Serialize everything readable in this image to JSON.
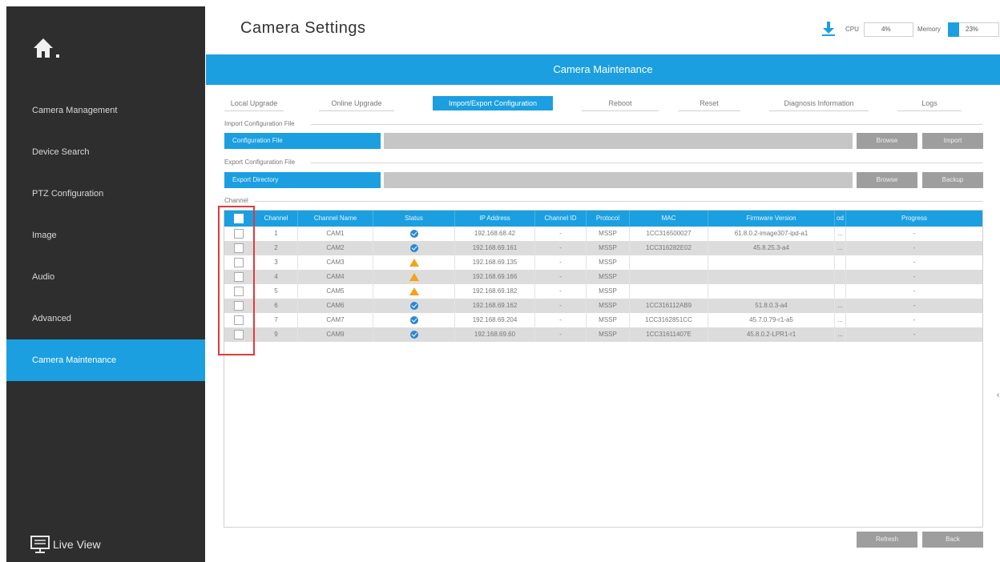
{
  "sidebar": {
    "items": [
      {
        "label": "Camera Management",
        "active": false
      },
      {
        "label": "Device Search",
        "active": false
      },
      {
        "label": "PTZ Configuration",
        "active": false
      },
      {
        "label": "Image",
        "active": false
      },
      {
        "label": "Audio",
        "active": false
      },
      {
        "label": "Advanced",
        "active": false
      },
      {
        "label": "Camera Maintenance",
        "active": true
      }
    ],
    "live_view_label": "Live View"
  },
  "header": {
    "title": "Camera Settings",
    "cpu_label": "CPU",
    "cpu_value": "4%",
    "memory_label": "Memory",
    "memory_value": "23%"
  },
  "banner": "Camera Maintenance",
  "tabs": [
    {
      "label": "Local Upgrade",
      "active": false
    },
    {
      "label": "Online Upgrade",
      "active": false
    },
    {
      "label": "Import/Export Configuration",
      "active": true
    },
    {
      "label": "Reboot",
      "active": false
    },
    {
      "label": "Reset",
      "active": false
    },
    {
      "label": "Diagnosis Information",
      "active": false
    },
    {
      "label": "Logs",
      "active": false
    }
  ],
  "import_section": {
    "title": "Import Configuration File",
    "field_label": "Configuration File",
    "browse_label": "Browse",
    "action_label": "Import"
  },
  "export_section": {
    "title": "Export Configuration File",
    "field_label": "Export Directory",
    "browse_label": "Browse",
    "action_label": "Backup"
  },
  "channel_section": {
    "title": "Channel",
    "columns": [
      "",
      "Channel",
      "Channel Name",
      "Status",
      "IP Address",
      "Channel ID",
      "Protocol",
      "MAC",
      "Firmware Version",
      "od",
      "Progress"
    ],
    "rows": [
      {
        "channel": "1",
        "name": "CAM1",
        "status": "ok",
        "ip": "192.168.68.42",
        "channel_id": "-",
        "protocol": "MSSP",
        "mac": "1CC316500027",
        "firmware": "61.8.0.2-image307-ipd-a1",
        "od": "...",
        "progress": "-"
      },
      {
        "channel": "2",
        "name": "CAM2",
        "status": "ok",
        "ip": "192.168.69.161",
        "channel_id": "-",
        "protocol": "MSSP",
        "mac": "1CC316282E02",
        "firmware": "45.8.25.3-a4",
        "od": "...",
        "progress": "-"
      },
      {
        "channel": "3",
        "name": "CAM3",
        "status": "warning",
        "ip": "192.168.69.135",
        "channel_id": "-",
        "protocol": "MSSP",
        "mac": "",
        "firmware": "",
        "od": "",
        "progress": "-"
      },
      {
        "channel": "4",
        "name": "CAM4",
        "status": "warning",
        "ip": "192.168.69.166",
        "channel_id": "-",
        "protocol": "MSSP",
        "mac": "",
        "firmware": "",
        "od": "",
        "progress": "-"
      },
      {
        "channel": "5",
        "name": "CAM5",
        "status": "warning",
        "ip": "192.168.69.182",
        "channel_id": "-",
        "protocol": "MSSP",
        "mac": "",
        "firmware": "",
        "od": "",
        "progress": "-"
      },
      {
        "channel": "6",
        "name": "CAM6",
        "status": "ok",
        "ip": "192.168.69.162",
        "channel_id": "-",
        "protocol": "MSSP",
        "mac": "1CC316112AB9",
        "firmware": "51.8.0.3-a4",
        "od": "...",
        "progress": "-"
      },
      {
        "channel": "7",
        "name": "CAM7",
        "status": "ok",
        "ip": "192.168.69.204",
        "channel_id": "-",
        "protocol": "MSSP",
        "mac": "1CC3162851CC",
        "firmware": "45.7.0.79-r1-a5",
        "od": "...",
        "progress": "-"
      },
      {
        "channel": "9",
        "name": "CAM9",
        "status": "ok",
        "ip": "192.168.69.60",
        "channel_id": "-",
        "protocol": "MSSP",
        "mac": "1CC31611407E",
        "firmware": "45.8.0.2-LPR1-r1",
        "od": "...",
        "progress": "-"
      }
    ]
  },
  "footer": {
    "refresh_label": "Refresh",
    "back_label": "Back"
  },
  "colors": {
    "accent": "#1b9fe0",
    "sidebar_bg": "#2e2e2e",
    "status_ok": "#2a86d6",
    "status_warning": "#f2a417",
    "highlight_box": "#e23a3a"
  }
}
